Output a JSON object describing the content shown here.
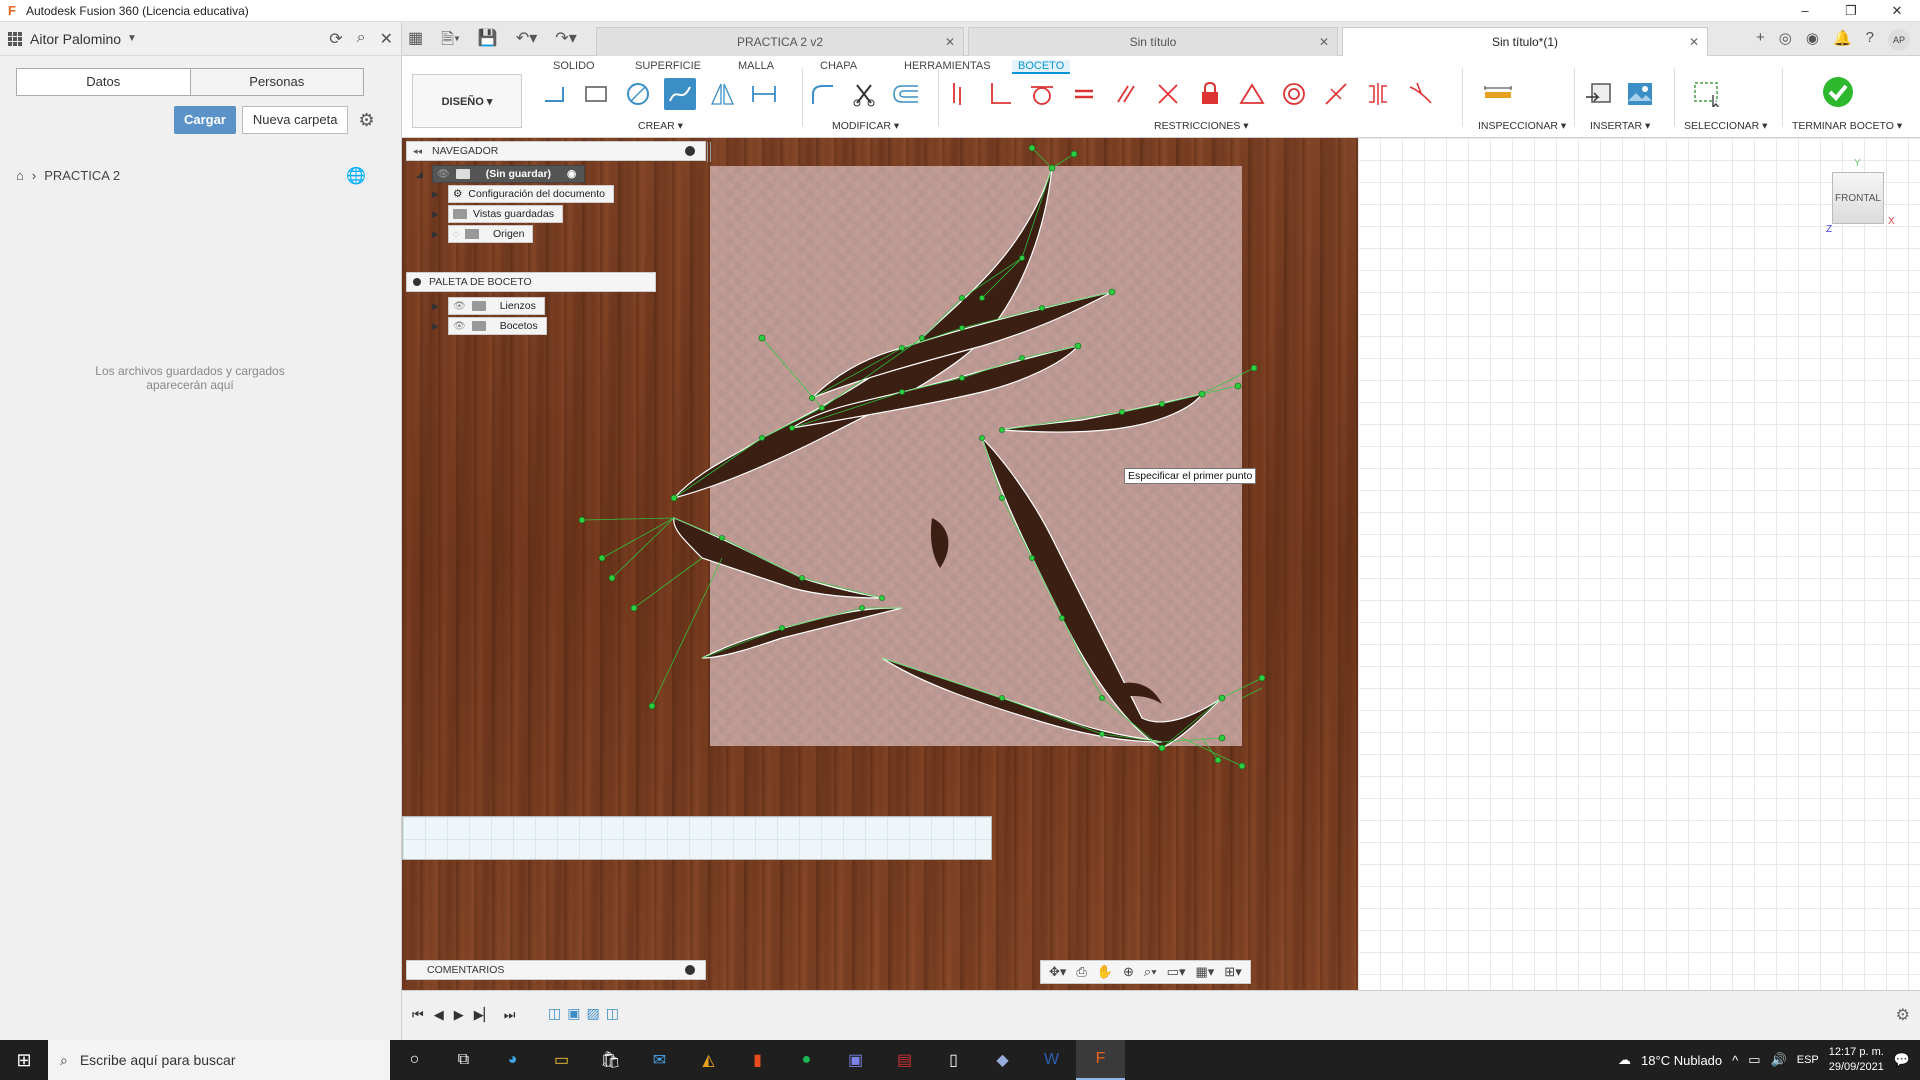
{
  "window": {
    "title": "Autodesk Fusion 360 (Licencia educativa)"
  },
  "left_panel": {
    "user": "Aitor Palomino",
    "tabs": [
      "Datos",
      "Personas"
    ],
    "upload_label": "Cargar",
    "new_folder_label": "Nueva carpeta",
    "breadcrumb": "PRACTICA 2",
    "empty_message": "Los archivos guardados y cargados aparecerán aquí"
  },
  "doc_tabs": [
    {
      "label": "PRACTICA 2 v2"
    },
    {
      "label": "Sin título"
    },
    {
      "label": "Sin título*(1)"
    }
  ],
  "user_initials": "AP",
  "ribbon": {
    "workspace_tabs": [
      "SOLIDO",
      "SUPERFICIE",
      "MALLA",
      "CHAPA",
      "HERRAMIENTAS",
      "BOCETO"
    ],
    "active_workspace_tab": "BOCETO",
    "design_label": "DISEÑO ▾",
    "groups": [
      "CREAR ▾",
      "MODIFICAR ▾",
      "RESTRICCIONES ▾",
      "INSPECCIONAR ▾",
      "INSERTAR ▾",
      "SELECCIONAR ▾",
      "TERMINAR BOCETO ▾"
    ]
  },
  "navigator": {
    "title": "NAVEGADOR",
    "root": "(Sin guardar)",
    "items": [
      "Configuración del documento",
      "Vistas guardadas",
      "Origen",
      "Lienzos",
      "Bocetos"
    ]
  },
  "sketch_palette": {
    "title": "PALETA DE BOCETO"
  },
  "tooltip": "Especificar el primer punto",
  "viewcube": {
    "face": "FRONTAL",
    "x": "X",
    "y": "Y",
    "z": "Z"
  },
  "comments": {
    "title": "COMENTARIOS"
  },
  "taskbar": {
    "search_placeholder": "Escribe aquí para buscar",
    "weather": "18°C Nublado",
    "lang": "ESP",
    "time": "12:17 p. m.",
    "date": "29/09/2021"
  },
  "colors": {
    "accent": "#0696d7",
    "sketch_green": "#2ecc40",
    "finish_green": "#2eb82e"
  }
}
